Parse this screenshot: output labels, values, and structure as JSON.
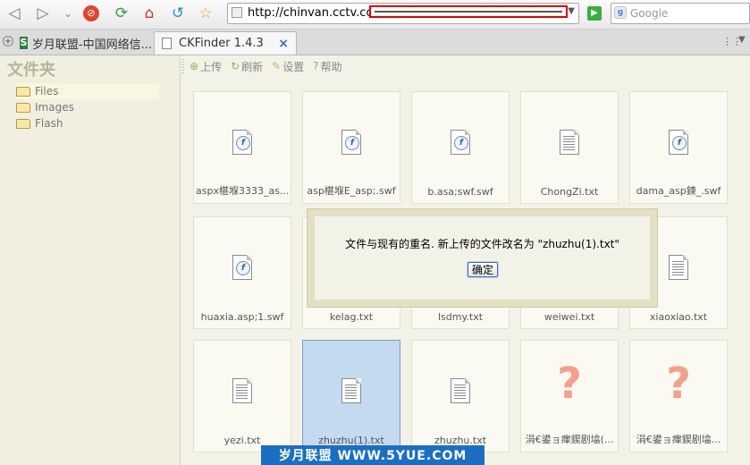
{
  "browser": {
    "url_visible": "http://chinvan.cctv.com/",
    "search_placeholder": "Google",
    "tabs": [
      {
        "label": "岁月联盟-中国网络信...",
        "favicon": "S"
      },
      {
        "label": "CKFinder 1.4.3",
        "close": "×"
      }
    ]
  },
  "sidebar": {
    "title": "文件夹",
    "folders": [
      {
        "label": "Files",
        "selected": true
      },
      {
        "label": "Images",
        "selected": false
      },
      {
        "label": "Flash",
        "selected": false
      }
    ]
  },
  "actions": [
    {
      "label": "上传",
      "icon": "upload-icon"
    },
    {
      "label": "刷新",
      "icon": "refresh-icon"
    },
    {
      "label": "设置",
      "icon": "settings-icon"
    },
    {
      "label": "帮助",
      "icon": "help-icon"
    }
  ],
  "files": [
    {
      "name": "aspx椹堢3333_as...",
      "type": "swf"
    },
    {
      "name": "asp椹堢E_asp;.swf",
      "type": "swf"
    },
    {
      "name": "b.asa;swf.swf",
      "type": "swf"
    },
    {
      "name": "ChongZi.txt",
      "type": "txt"
    },
    {
      "name": "dama_asp鍊_.swf",
      "type": "swf"
    },
    {
      "name": "huaxia.asp;1.swf",
      "type": "swf"
    },
    {
      "name": "kelag.txt",
      "type": "txt"
    },
    {
      "name": "lsdmy.txt",
      "type": "txt"
    },
    {
      "name": "weiwei.txt",
      "type": "txt"
    },
    {
      "name": "xiaoxiao.txt",
      "type": "txt"
    },
    {
      "name": "yezi.txt",
      "type": "txt"
    },
    {
      "name": "zhuzhu(1).txt",
      "type": "txt",
      "selected": true
    },
    {
      "name": "zhuzhu.txt",
      "type": "txt"
    },
    {
      "name": "涓€鍙ョ瘒鍥剧墖(...",
      "type": "unknown"
    },
    {
      "name": "涓€鍙ョ瘒鍥剧墖...",
      "type": "unknown"
    }
  ],
  "dialog": {
    "message": "文件与现有的重名. 新上传的文件改名为 \"zhuzhu(1).txt\"",
    "ok_label": "确定"
  },
  "watermark": "岁月联盟 WWW.5YUE.COM",
  "colors": {
    "panel_bg": "#f3f2e6",
    "selected_thumb": "#c5d9f1",
    "question_mark": "#f3a08c",
    "watermark_bg": "#1a6fc2"
  }
}
